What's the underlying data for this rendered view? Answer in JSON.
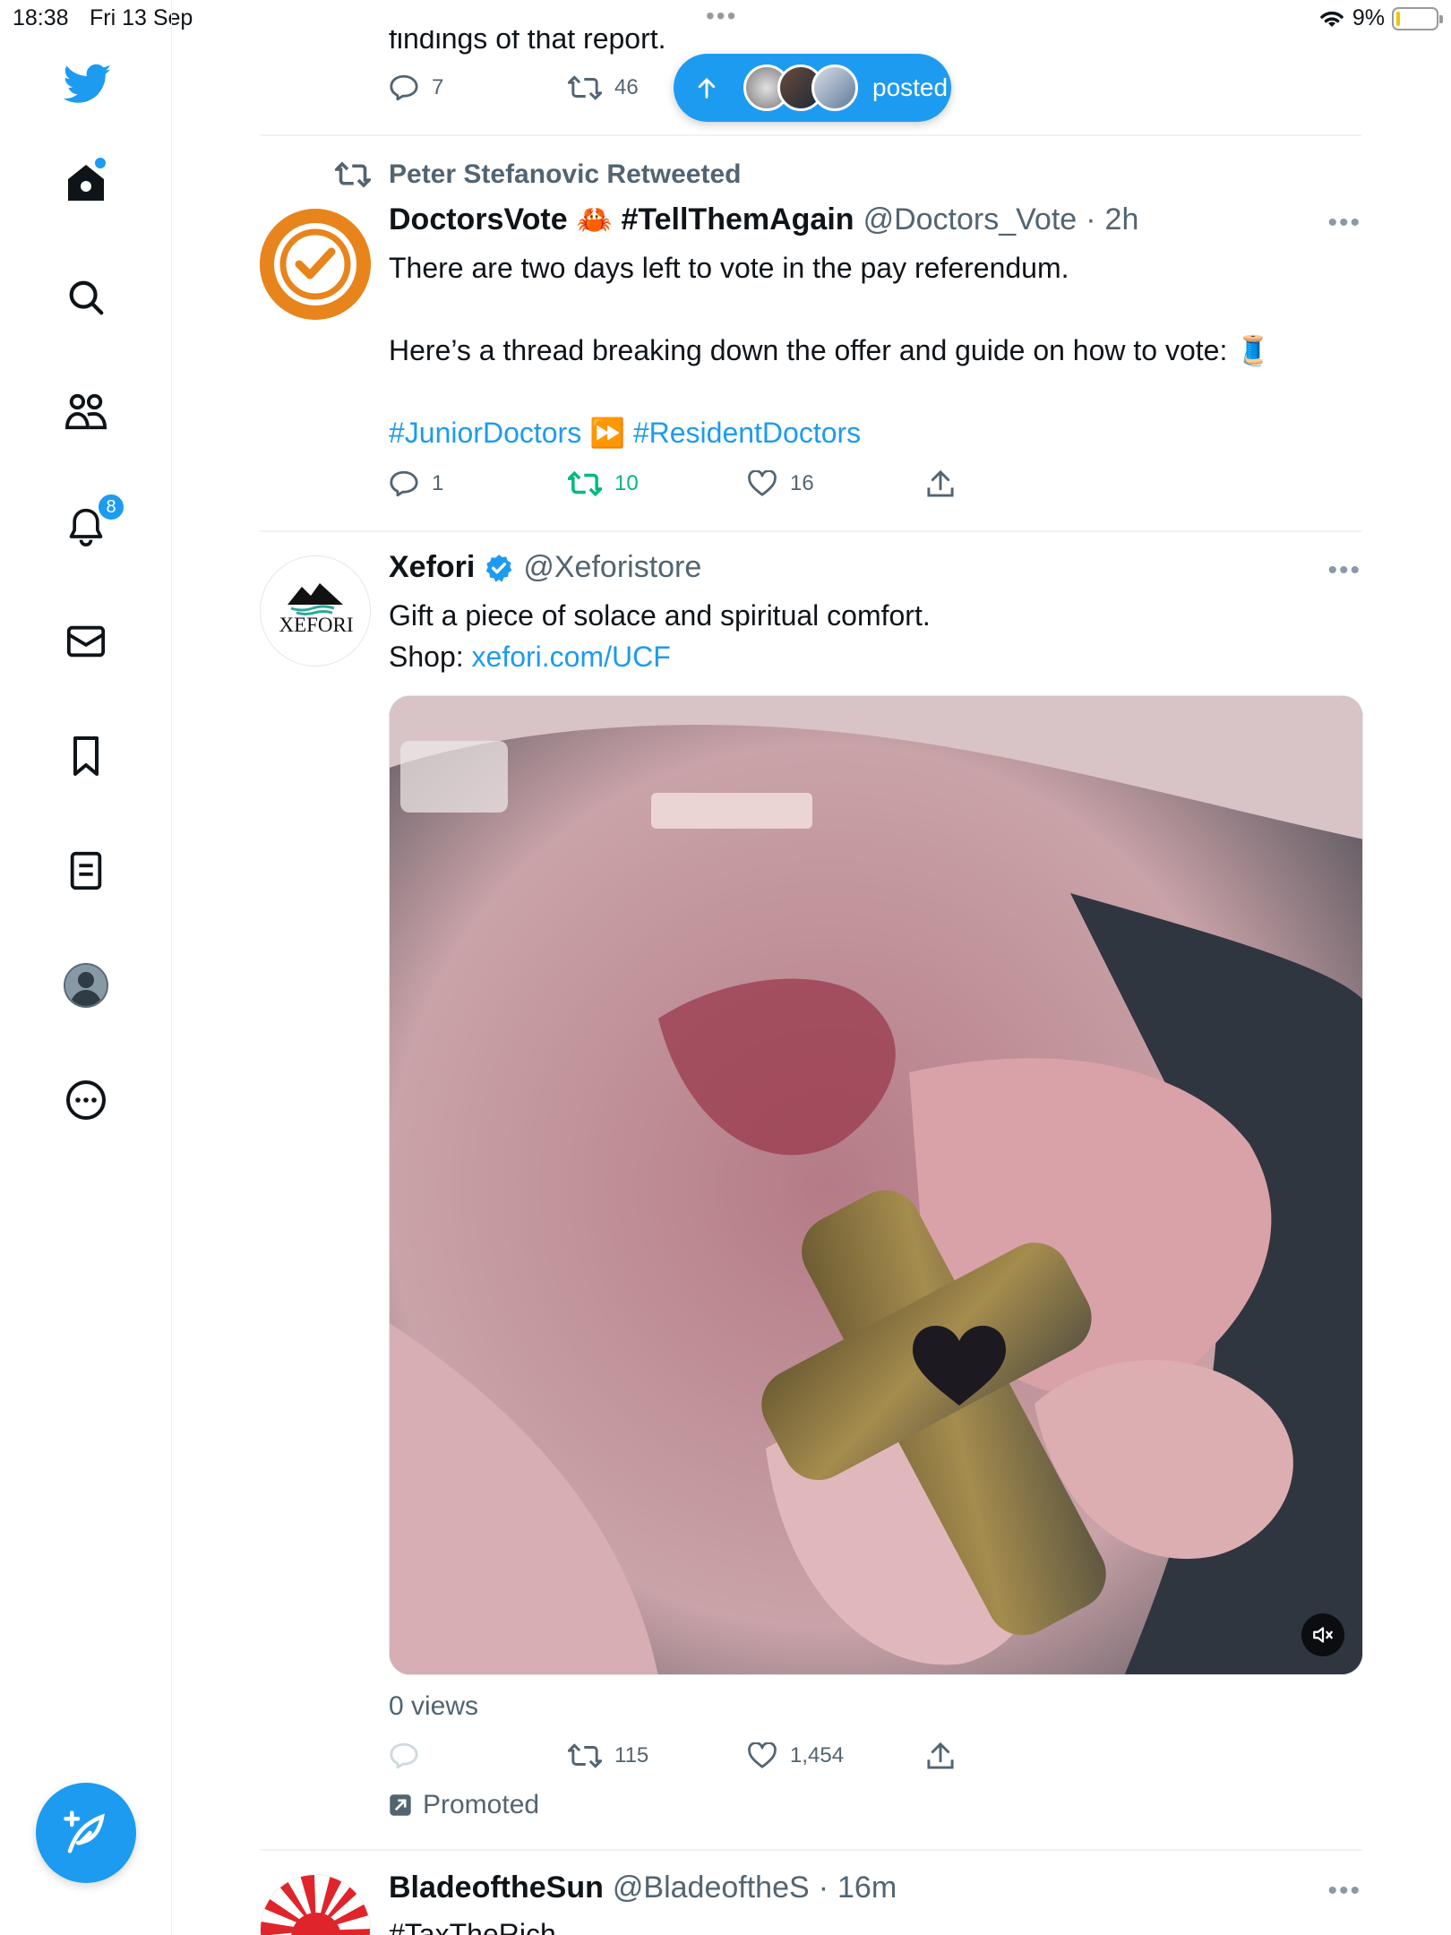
{
  "status_bar": {
    "time": "18:38",
    "date": "Fri 13 Sep",
    "battery": "9%",
    "battery_level": 0.09
  },
  "sidebar": {
    "items": [
      {
        "name": "home",
        "icon": "home-icon"
      },
      {
        "name": "explore",
        "icon": "search-icon"
      },
      {
        "name": "communities",
        "icon": "communities-icon"
      },
      {
        "name": "notifications",
        "icon": "bell-icon",
        "badge": "8"
      },
      {
        "name": "messages",
        "icon": "envelope-icon"
      },
      {
        "name": "bookmarks",
        "icon": "bookmark-icon"
      },
      {
        "name": "lists",
        "icon": "list-icon"
      },
      {
        "name": "profile",
        "icon": "profile-icon"
      },
      {
        "name": "more",
        "icon": "more-circle-icon"
      }
    ],
    "compose_icon": "feather-plus-icon"
  },
  "posted_pill": {
    "label": "posted"
  },
  "prev_tweet": {
    "partial_text": "findings of that report.",
    "replies": "7",
    "retweets": "46"
  },
  "tweet1": {
    "retweeted_by": "Peter Stefanovic Retweeted",
    "name": "DoctorsVote",
    "crab": "🦀",
    "hashtag_name": "#TellThemAgain",
    "handle": "@Doctors_Vote",
    "time": "2h",
    "line1": "There are two days left to vote in the pay referendum.",
    "line2": "Here’s a thread breaking down the offer and guide on how to vote:",
    "emoji": "🧵",
    "hashtag1": "#JuniorDoctors",
    "arrow_emoji": "⏩",
    "hashtag2": "#ResidentDoctors",
    "replies": "1",
    "retweets": "10",
    "likes": "16",
    "retweet_color": "#00ba7c"
  },
  "tweet2": {
    "name": "Xefori",
    "handle": "@Xeforistore",
    "avatar_text": "XEFORI",
    "text": "Gift a piece of solace and spiritual comfort.",
    "shop_label": "Shop: ",
    "shop_link": "xefori.com/UCF",
    "views": "0 views",
    "retweets": "115",
    "likes": "1,454",
    "promoted": "Promoted"
  },
  "tweet3": {
    "name": "BladeoftheSun",
    "handle": "@BladeoftheS",
    "time": "16m",
    "hashtag": "#TaxTheRich"
  },
  "colors": {
    "accent": "#1d9bf0",
    "text": "#0f1419",
    "secondary": "#536471"
  }
}
